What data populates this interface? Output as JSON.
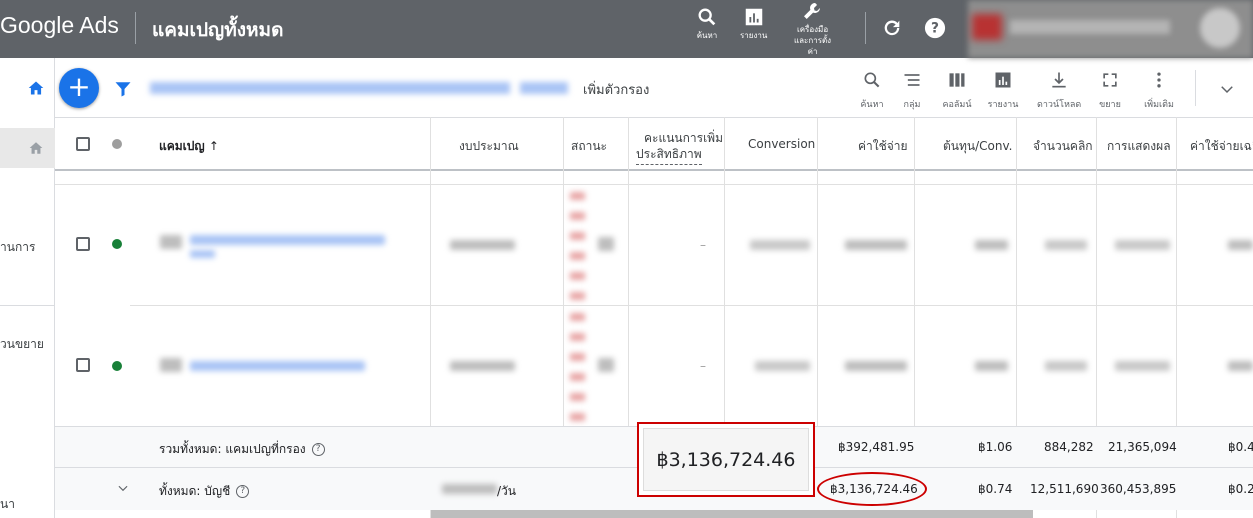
{
  "header": {
    "logo": "Google Ads",
    "title": "แคมเปญทั้งหมด",
    "tools": [
      {
        "label": "ค้นหา",
        "icon": "search-icon"
      },
      {
        "label": "รายงาน",
        "icon": "reports-icon"
      },
      {
        "label_line1": "เครื่องมือ",
        "label_line2": "และการตั้ง",
        "label_line3": "ค่า",
        "icon": "wrench-icon"
      }
    ],
    "refresh_icon": "refresh-icon",
    "help_icon": "help-icon"
  },
  "rail": {
    "text1": "านการ",
    "text2": "วนขยาย",
    "text3": "นา"
  },
  "toolbar": {
    "add_label": "+",
    "add_filter": "เพิ่มตัวกรอง",
    "buttons": [
      {
        "label": "ค้นหา",
        "icon": "search-icon"
      },
      {
        "label": "กลุ่ม",
        "icon": "segment-icon"
      },
      {
        "label": "คอลัมน์",
        "icon": "columns-icon"
      },
      {
        "label": "รายงาน",
        "icon": "reports-icon"
      },
      {
        "label": "ดาวน์โหลด",
        "icon": "download-icon"
      },
      {
        "label": "ขยาย",
        "icon": "expand-icon"
      },
      {
        "label": "เพิ่มเติม",
        "icon": "more-icon"
      }
    ]
  },
  "table": {
    "columns": {
      "campaign": "แคมเปญ",
      "budget": "งบประมาณ",
      "status": "สถานะ",
      "opt_score_1": "คะแนนการเพิ่ม",
      "opt_score_2": "ประสิทธิภาพ",
      "conversion": "Conversion",
      "cost": "ค่าใช้จ่าย",
      "cost_per_conv": "ต้นทุน/Conv.",
      "clicks": "จำนวนคลิก",
      "impressions": "การแสดงผล",
      "avg_cost": "ค่าใช้จ่ายเฉลี่"
    },
    "rows": [
      {
        "status_color": "#188038",
        "opt_score": "–"
      },
      {
        "status_color": "#188038",
        "opt_score": "–"
      }
    ],
    "total_filtered": {
      "label": "รวมทั้งหมด: แคมเปญที่กรอง",
      "cost": "฿392,481.95",
      "cost_per_conv": "฿1.06",
      "clicks": "884,282",
      "impressions": "21,365,094",
      "avg_cost": "฿0.4"
    },
    "total_account": {
      "label": "ทั้งหมด: บัญชี",
      "budget_suffix": "/วัน",
      "cost": "฿3,136,724.46",
      "cost_per_conv": "฿0.74",
      "clicks": "12,511,690",
      "impressions": "360,453,895",
      "avg_cost": "฿0.2"
    },
    "callout_value": "฿3,136,724.46"
  },
  "colors": {
    "header_bg": "#5f6368",
    "accent": "#1a73e8",
    "status_enabled": "#188038",
    "highlight": "#cc0000"
  }
}
